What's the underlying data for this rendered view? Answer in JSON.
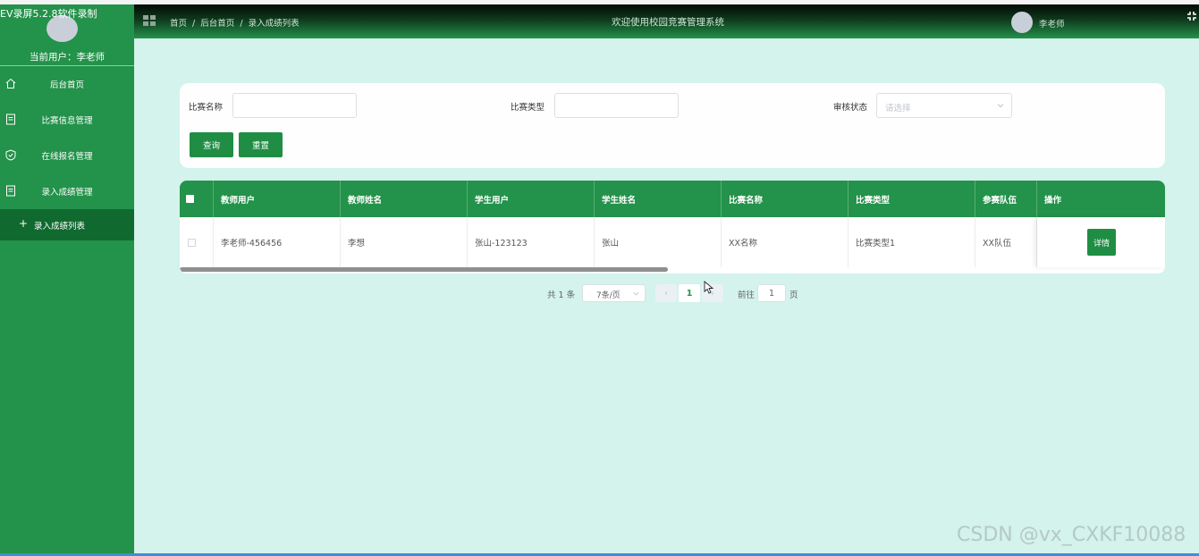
{
  "recorder_label": "EV录屏5.2.8软件录制",
  "sidebar": {
    "current_user": "当前用户：李老师",
    "menu": [
      {
        "label": "后台首页",
        "icon": "home-icon"
      },
      {
        "label": "比赛信息管理",
        "icon": "document-icon"
      },
      {
        "label": "在线报名管理",
        "icon": "shield-check-icon"
      },
      {
        "label": "录入成绩管理",
        "icon": "document-icon"
      }
    ],
    "submenu": {
      "prefix": "+",
      "label": "录入成绩列表"
    }
  },
  "header": {
    "breadcrumb": [
      "首页",
      "/",
      "后台首页",
      "/",
      "录入成绩列表"
    ],
    "title": "欢迎使用校园竞赛管理系统",
    "user": "李老师"
  },
  "search": {
    "name_label": "比赛名称",
    "name_value": "",
    "type_label": "比赛类型",
    "type_value": "",
    "status_label": "审核状态",
    "status_placeholder": "请选择",
    "query_button": "查询",
    "reset_button": "重置"
  },
  "table": {
    "columns": [
      "教师用户",
      "教师姓名",
      "学生用户",
      "学生姓名",
      "比赛名称",
      "比赛类型",
      "参赛队伍",
      "操作"
    ],
    "rows": [
      {
        "teacher_user": "李老师-456456",
        "teacher_name": "李想",
        "student_user": "张山-123123",
        "student_name": "张山",
        "contest_name": "XX名称",
        "contest_type": "比赛类型1",
        "team": "XX队伍",
        "action": "详情"
      }
    ]
  },
  "pagination": {
    "total": "共 1 条",
    "page_size": "7条/页",
    "prev": "‹",
    "current": "1",
    "next": "›",
    "goto_label": "前往",
    "goto_value": "1",
    "page_unit": "页"
  },
  "watermark": "CSDN @vx_CXKF10088",
  "colors": {
    "primary": "#23924a",
    "content_bg": "#d3f3ec",
    "active_menu": "#106a30"
  }
}
